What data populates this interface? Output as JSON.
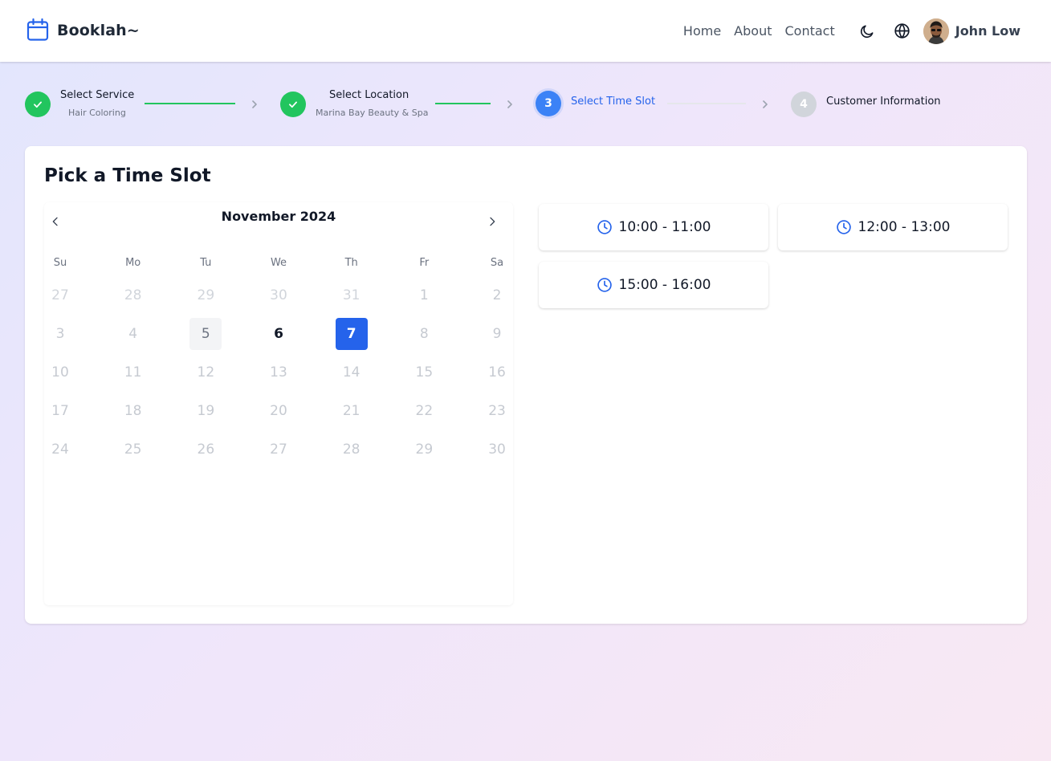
{
  "header": {
    "brand": "Booklah~",
    "nav": [
      "Home",
      "About",
      "Contact"
    ],
    "user_name": "John Low"
  },
  "stepper": {
    "steps": [
      {
        "title": "Select Service",
        "subtitle": "Hair Coloring",
        "status": "done"
      },
      {
        "title": "Select Location",
        "subtitle": "Marina Bay Beauty & Spa",
        "status": "done"
      },
      {
        "title": "Select Time Slot",
        "number": "3",
        "status": "active"
      },
      {
        "title": "Customer Information",
        "number": "4",
        "status": "todo"
      }
    ]
  },
  "page": {
    "title": "Pick a Time Slot"
  },
  "calendar": {
    "month_label": "November 2024",
    "weekdays": [
      "Su",
      "Mo",
      "Tu",
      "We",
      "Th",
      "Fr",
      "Sa"
    ],
    "weeks": [
      [
        "27",
        "28",
        "29",
        "30",
        "31",
        "1",
        "2"
      ],
      [
        "3",
        "4",
        "5",
        "6",
        "7",
        "8",
        "9"
      ],
      [
        "10",
        "11",
        "12",
        "13",
        "14",
        "15",
        "16"
      ],
      [
        "17",
        "18",
        "19",
        "20",
        "21",
        "22",
        "23"
      ],
      [
        "24",
        "25",
        "26",
        "27",
        "28",
        "29",
        "30"
      ]
    ],
    "today": "5",
    "available": [
      "6",
      "7"
    ],
    "selected": "7"
  },
  "time_slots": [
    "10:00 - 11:00",
    "12:00 - 13:00",
    "15:00 - 16:00"
  ],
  "colors": {
    "primary": "#2563eb",
    "success": "#22c55e",
    "inactive": "#d1d5db"
  },
  "icons": {
    "brand": "calendar-icon",
    "theme": "moon-icon",
    "language": "globe-icon",
    "slot": "clock-icon",
    "step_done": "check-icon",
    "prev": "chevron-left-icon",
    "next": "chevron-right-icon"
  }
}
